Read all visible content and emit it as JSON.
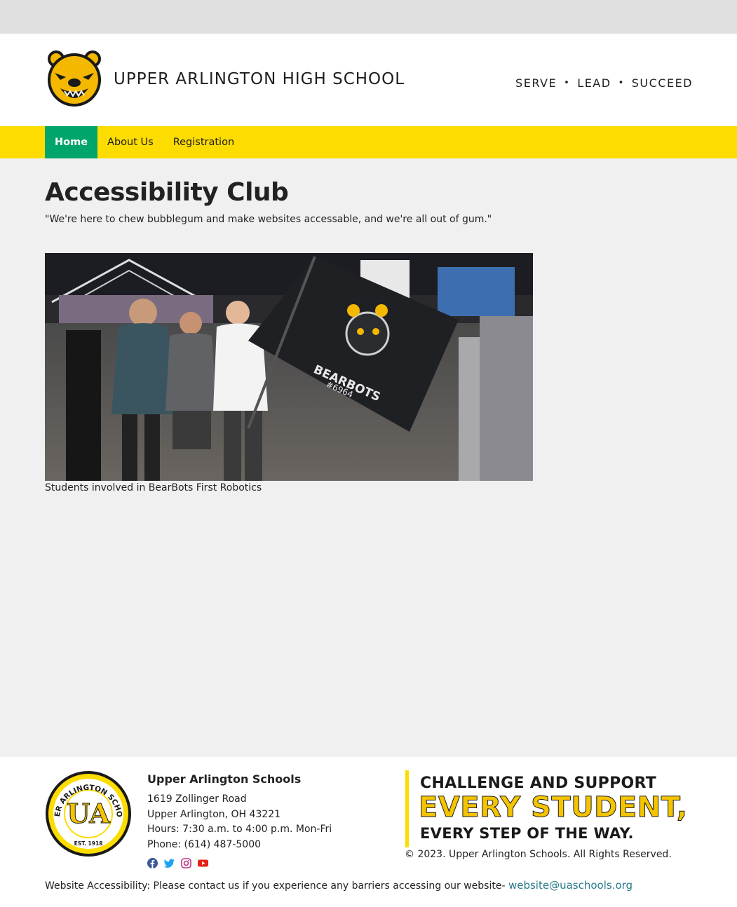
{
  "header": {
    "school_name": "UPPER ARLINGTON HIGH SCHOOL",
    "motto": [
      "SERVE",
      "LEAD",
      "SUCCEED"
    ],
    "motto_separator": "•"
  },
  "nav": {
    "items": [
      {
        "label": "Home",
        "active": true
      },
      {
        "label": "About Us",
        "active": false
      },
      {
        "label": "Registration",
        "active": false
      }
    ]
  },
  "main": {
    "title": "Accessibility Club",
    "quote": "\"We're here to chew bubblegum and make websites accessable, and we're all out of gum.\"",
    "photo_caption": "Students involved in BearBots First Robotics",
    "flag_text": "BEARBOTS",
    "flag_number": "#6964"
  },
  "footer": {
    "org_name": "Upper Arlington Schools",
    "address_1": "1619 Zollinger Road",
    "address_2": "Upper Arlington, OH 43221",
    "hours": "Hours: 7:30 a.m. to 4:00 p.m. Mon-Fri",
    "phone": "Phone: (614) 487-5000",
    "seal_text": "UPPER ARLINGTON SCHOOLS",
    "seal_initials": "UA",
    "seal_est": "EST. 1918",
    "social": [
      "facebook-icon",
      "twitter-icon",
      "instagram-icon",
      "youtube-icon"
    ],
    "banner_line_1": "CHALLENGE AND SUPPORT",
    "banner_line_2": "EVERY STUDENT,",
    "banner_line_3": "EVERY STEP OF THE WAY.",
    "copyright": "© 2023. Upper Arlington Schools. All Rights Reserved.",
    "accessibility_text": "Website Accessibility: Please contact us if you experience any barriers accessing our website- ",
    "accessibility_email": "website@uaschools.org"
  },
  "colors": {
    "nav_bg": "#fddc00",
    "nav_active": "#00a56a",
    "link": "#2a7a8a",
    "gold": "#f5c400"
  }
}
